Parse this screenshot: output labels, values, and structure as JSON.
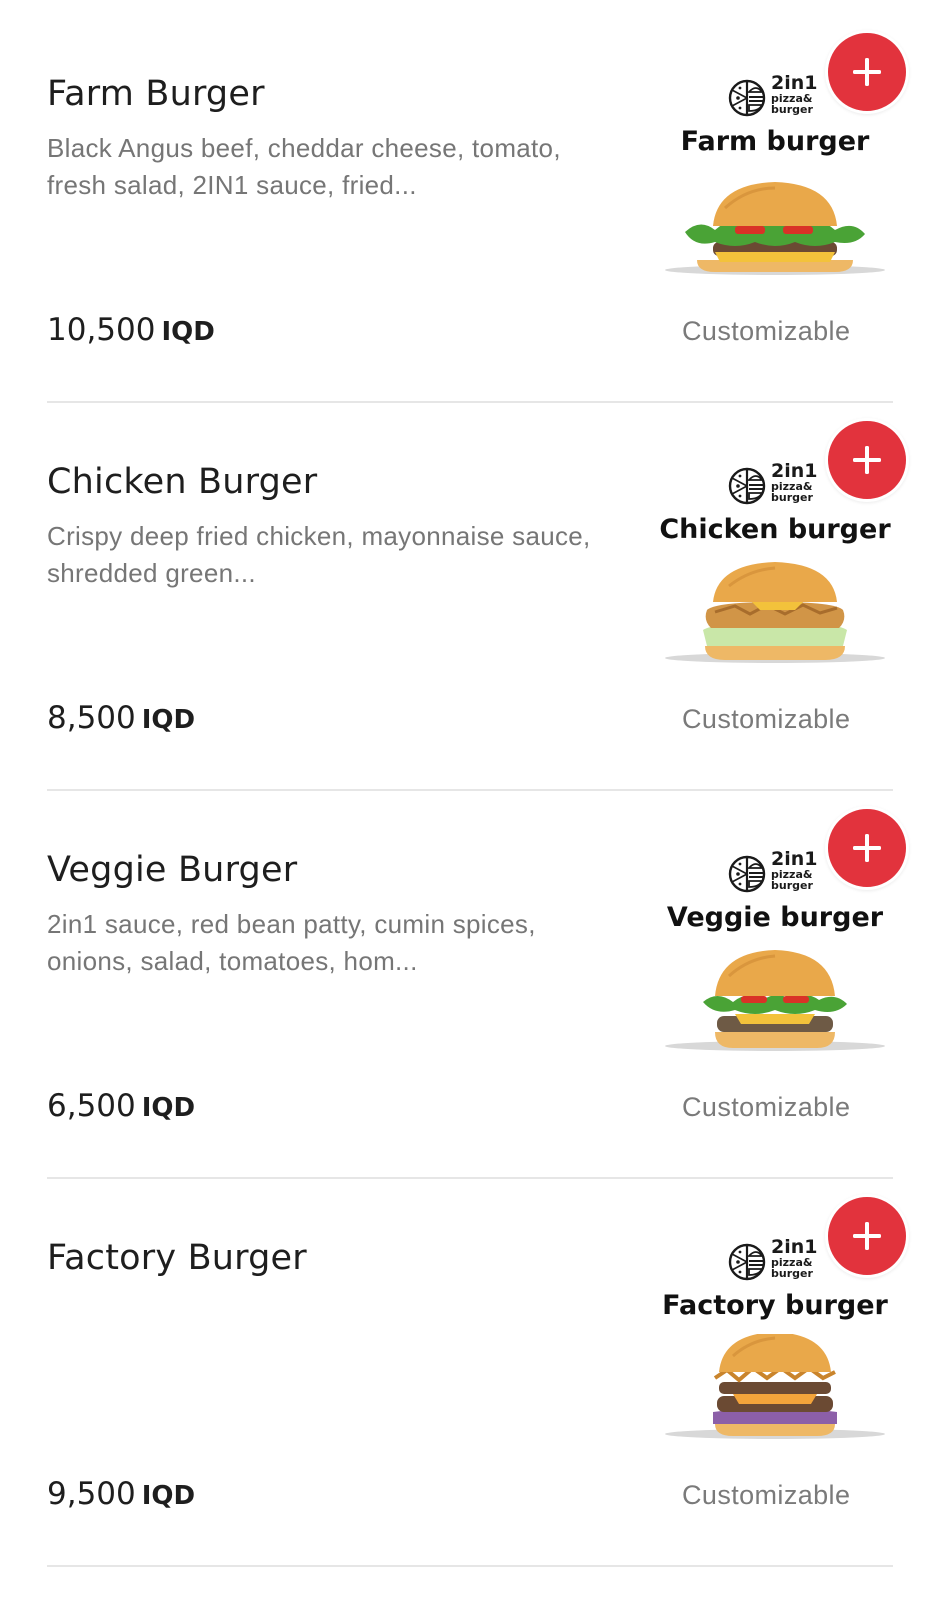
{
  "items": [
    {
      "name": "Farm Burger",
      "description": "Black Angus beef, cheddar cheese, tomato, fresh salad, 2IN1 sauce, fried...",
      "price": "10,500",
      "currency": "IQD",
      "customizable_label": "Customizable",
      "image_title": "Farm burger",
      "burger_style": "farm"
    },
    {
      "name": "Chicken Burger",
      "description": "Crispy deep fried chicken, mayonnaise sauce, shredded green...",
      "price": "8,500",
      "currency": "IQD",
      "customizable_label": "Customizable",
      "image_title": "Chicken burger",
      "burger_style": "chicken"
    },
    {
      "name": "Veggie Burger",
      "description": "2in1 sauce, red bean patty, cumin spices, onions, salad, tomatoes, hom...",
      "price": "6,500",
      "currency": "IQD",
      "customizable_label": "Customizable",
      "image_title": "Veggie burger",
      "burger_style": "veggie"
    },
    {
      "name": "Factory Burger",
      "description": "",
      "price": "9,500",
      "currency": "IQD",
      "customizable_label": "Customizable",
      "image_title": "Factory burger",
      "burger_style": "factory"
    }
  ],
  "brand": {
    "line1": "2in1",
    "line2": "pizza&",
    "line3": "burger"
  },
  "add_icon": "plus-icon",
  "colors": {
    "accent": "#e2333d",
    "divider": "#e6e6e6",
    "description": "#767676",
    "title": "#1e1e1e"
  }
}
